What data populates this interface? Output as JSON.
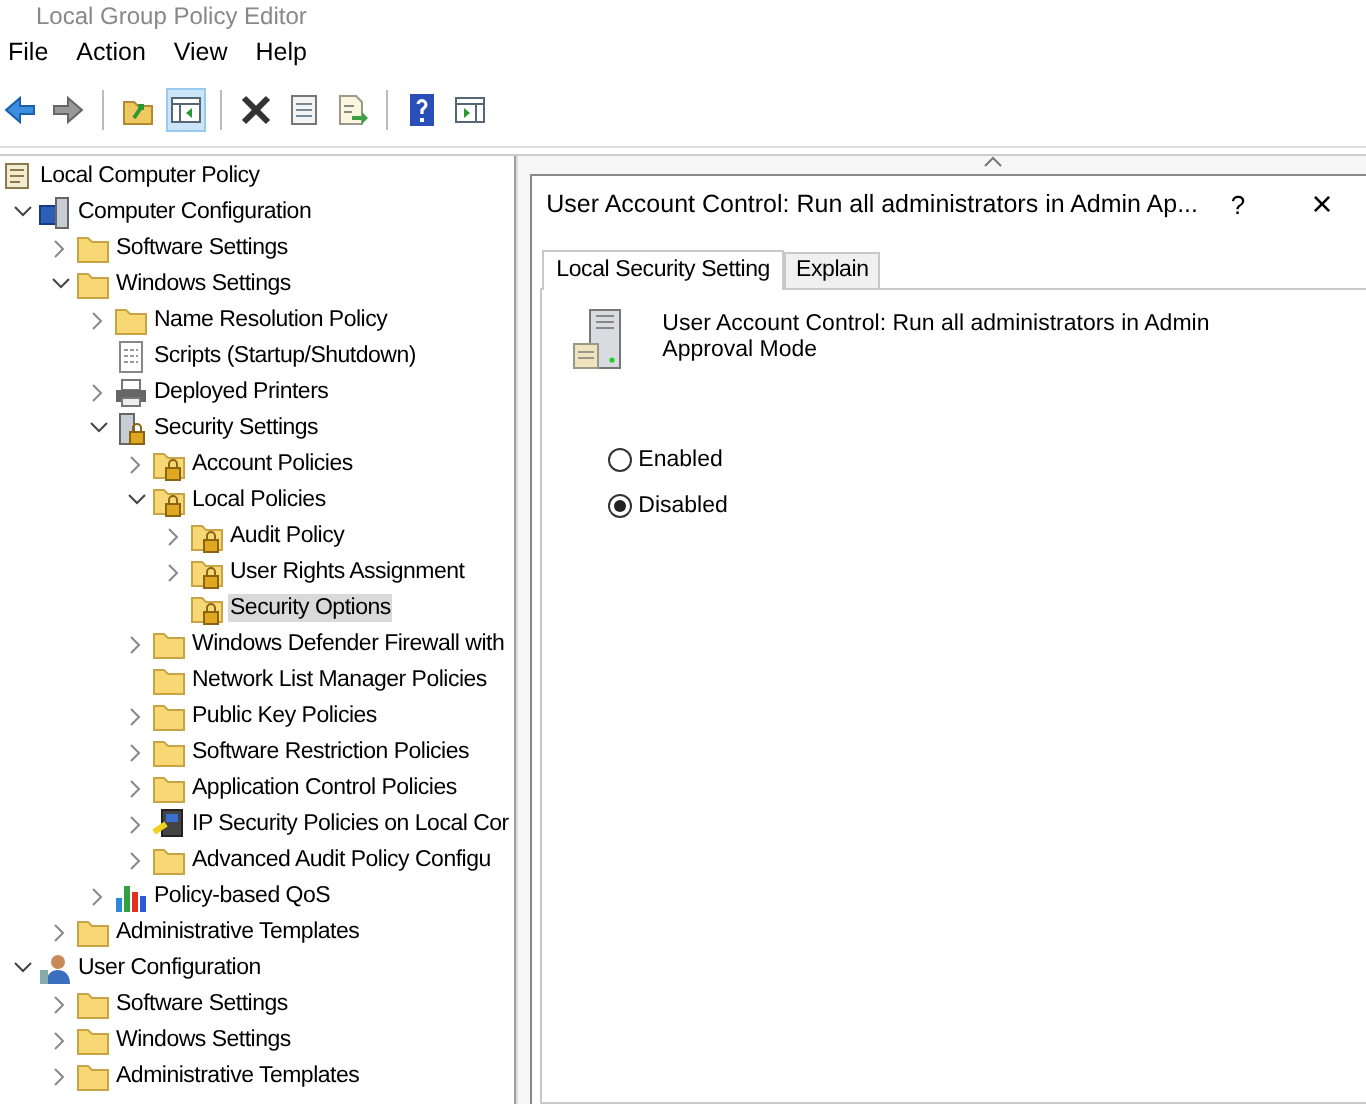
{
  "window": {
    "title": "Local Group Policy Editor"
  },
  "menu": [
    "File",
    "Action",
    "View",
    "Help"
  ],
  "toolbar": [
    {
      "kind": "back",
      "pressed": false
    },
    {
      "kind": "forward",
      "pressed": false
    },
    {
      "kind": "separator"
    },
    {
      "kind": "up",
      "pressed": false
    },
    {
      "kind": "tree",
      "pressed": true
    },
    {
      "kind": "separator"
    },
    {
      "kind": "delete",
      "pressed": false
    },
    {
      "kind": "properties",
      "pressed": false
    },
    {
      "kind": "export",
      "pressed": false
    },
    {
      "kind": "separator"
    },
    {
      "kind": "help",
      "pressed": false
    },
    {
      "kind": "pane",
      "pressed": false
    }
  ],
  "tree": [
    {
      "label": "Local Computer Policy",
      "kind": "policy",
      "selected": false,
      "children": [
        {
          "label": "Computer Configuration",
          "kind": "computer",
          "expanded": true,
          "selected": false,
          "children": [
            {
              "label": "Software Settings",
              "kind": "folder",
              "expanded": false,
              "selected": false
            },
            {
              "label": "Windows Settings",
              "kind": "folder",
              "expanded": true,
              "selected": false,
              "children": [
                {
                  "label": "Name Resolution Policy",
                  "kind": "folder",
                  "expanded": false,
                  "selected": false
                },
                {
                  "label": "Scripts (Startup/Shutdown)",
                  "kind": "script",
                  "selected": false
                },
                {
                  "label": "Deployed Printers",
                  "kind": "printer",
                  "expanded": false,
                  "selected": false
                },
                {
                  "label": "Security Settings",
                  "kind": "security",
                  "expanded": true,
                  "selected": false,
                  "children": [
                    {
                      "label": "Account Policies",
                      "kind": "lockfolder",
                      "expanded": false,
                      "selected": false
                    },
                    {
                      "label": "Local Policies",
                      "kind": "lockfolder",
                      "expanded": true,
                      "selected": false,
                      "children": [
                        {
                          "label": "Audit Policy",
                          "kind": "lockfolder",
                          "expanded": false,
                          "selected": false
                        },
                        {
                          "label": "User Rights Assignment",
                          "kind": "lockfolder",
                          "expanded": false,
                          "selected": false
                        },
                        {
                          "label": "Security Options",
                          "kind": "lockfolder",
                          "selected": true
                        }
                      ]
                    },
                    {
                      "label": "Windows Defender Firewall with",
                      "kind": "folder",
                      "expanded": false,
                      "selected": false
                    },
                    {
                      "label": "Network List Manager Policies",
                      "kind": "folder",
                      "selected": false
                    },
                    {
                      "label": "Public Key Policies",
                      "kind": "folder",
                      "expanded": false,
                      "selected": false
                    },
                    {
                      "label": "Software Restriction Policies",
                      "kind": "folder",
                      "expanded": false,
                      "selected": false
                    },
                    {
                      "label": "Application Control Policies",
                      "kind": "folder",
                      "expanded": false,
                      "selected": false
                    },
                    {
                      "label": "IP Security Policies on Local Cor",
                      "kind": "ipsec",
                      "expanded": false,
                      "selected": false
                    },
                    {
                      "label": "Advanced Audit Policy Configu",
                      "kind": "folder",
                      "expanded": false,
                      "selected": false
                    }
                  ]
                },
                {
                  "label": "Policy-based QoS",
                  "kind": "qos",
                  "expanded": false,
                  "selected": false
                }
              ]
            },
            {
              "label": "Administrative Templates",
              "kind": "folder",
              "expanded": false,
              "selected": false
            }
          ]
        },
        {
          "label": "User Configuration",
          "kind": "user",
          "expanded": true,
          "selected": false,
          "children": [
            {
              "label": "Software Settings",
              "kind": "folder",
              "expanded": false,
              "selected": false
            },
            {
              "label": "Windows Settings",
              "kind": "folder",
              "expanded": false,
              "selected": false
            },
            {
              "label": "Administrative Templates",
              "kind": "folder",
              "expanded": false,
              "selected": false
            }
          ]
        }
      ]
    }
  ],
  "dialog": {
    "title": "User Account Control: Run all administrators in Admin Ap...",
    "help_button": "?",
    "close_button": "×",
    "tabs": [
      {
        "label": "Local Security Setting",
        "selected": true
      },
      {
        "label": "Explain",
        "selected": false
      }
    ],
    "policy_name": "User Account Control: Run all administrators in Admin Approval Mode",
    "options": [
      {
        "label": "Enabled",
        "selected": false
      },
      {
        "label": "Disabled",
        "selected": true
      }
    ]
  }
}
